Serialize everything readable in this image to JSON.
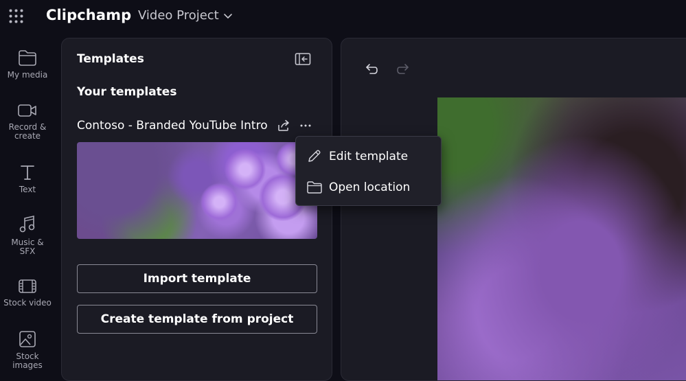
{
  "app": {
    "title": "Clipchamp",
    "project_name": "Video Project"
  },
  "sidebar": {
    "items": [
      {
        "line1": "My media",
        "line2": ""
      },
      {
        "line1": "Record &",
        "line2": "create"
      },
      {
        "line1": "Text",
        "line2": ""
      },
      {
        "line1": "Music &",
        "line2": "SFX"
      },
      {
        "line1": "Stock video",
        "line2": ""
      },
      {
        "line1": "Stock",
        "line2": "images"
      }
    ]
  },
  "templates_panel": {
    "title": "Templates",
    "section_title": "Your templates",
    "template_name": "Contoso - Branded YouTube Intro",
    "import_button": "Import template",
    "create_button": "Create template from project"
  },
  "context_menu": {
    "items": [
      "Edit template",
      "Open location"
    ]
  },
  "colors": {
    "background": "#0e0e17",
    "panel": "#1b1b24",
    "menu": "#202029",
    "text": "#ffffff",
    "muted": "#a9a9b4"
  },
  "icons": [
    "app-grid-icon",
    "chevron-down-icon",
    "folder-icon",
    "camera-icon",
    "text-icon",
    "music-note-icon",
    "film-icon",
    "image-icon",
    "collapse-panel-icon",
    "share-icon",
    "more-icon",
    "undo-icon",
    "redo-icon",
    "pencil-icon"
  ]
}
